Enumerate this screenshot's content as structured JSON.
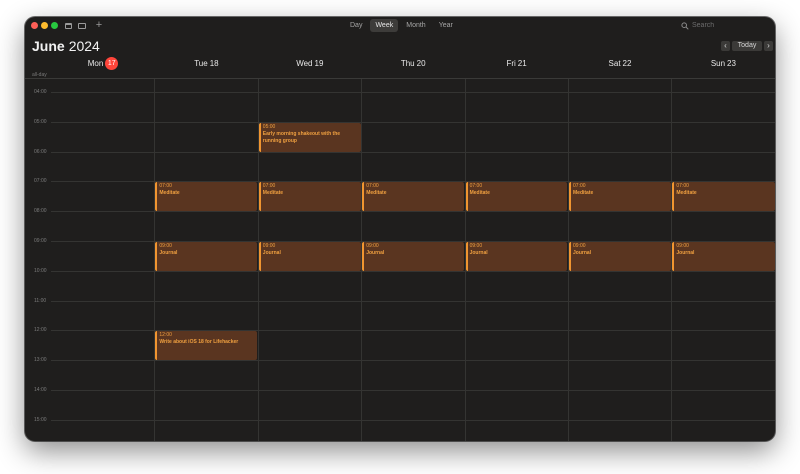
{
  "toolbar": {
    "views": [
      "Day",
      "Week",
      "Month",
      "Year"
    ],
    "active_view": "Week",
    "search_placeholder": "Search"
  },
  "header": {
    "month": "June",
    "year": "2024",
    "today_label": "Today"
  },
  "allday_label": "all-day",
  "days": [
    {
      "dow": "Mon",
      "num": "17",
      "today": true
    },
    {
      "dow": "Tue",
      "num": "18",
      "today": false
    },
    {
      "dow": "Wed",
      "num": "19",
      "today": false
    },
    {
      "dow": "Thu",
      "num": "20",
      "today": false
    },
    {
      "dow": "Fri",
      "num": "21",
      "today": false
    },
    {
      "dow": "Sat",
      "num": "22",
      "today": false
    },
    {
      "dow": "Sun",
      "num": "23",
      "today": false
    }
  ],
  "hours": [
    "04:00",
    "05:00",
    "06:00",
    "07:00",
    "08:00",
    "09:00",
    "10:00",
    "11:00",
    "12:00",
    "13:00",
    "14:00",
    "15:00"
  ],
  "events": [
    {
      "day": 2,
      "start": "05:00",
      "end": "06:00",
      "time": "05:00",
      "title": "Early morning shakeout with the running group"
    },
    {
      "day": 1,
      "start": "07:00",
      "end": "08:00",
      "time": "07:00",
      "title": "Meditate"
    },
    {
      "day": 2,
      "start": "07:00",
      "end": "08:00",
      "time": "07:00",
      "title": "Meditate"
    },
    {
      "day": 3,
      "start": "07:00",
      "end": "08:00",
      "time": "07:00",
      "title": "Meditate"
    },
    {
      "day": 4,
      "start": "07:00",
      "end": "08:00",
      "time": "07:00",
      "title": "Meditate"
    },
    {
      "day": 5,
      "start": "07:00",
      "end": "08:00",
      "time": "07:00",
      "title": "Meditate"
    },
    {
      "day": 6,
      "start": "07:00",
      "end": "08:00",
      "time": "07:00",
      "title": "Meditate"
    },
    {
      "day": 1,
      "start": "09:00",
      "end": "10:00",
      "time": "09:00",
      "title": "Journal"
    },
    {
      "day": 2,
      "start": "09:00",
      "end": "10:00",
      "time": "09:00",
      "title": "Journal"
    },
    {
      "day": 3,
      "start": "09:00",
      "end": "10:00",
      "time": "09:00",
      "title": "Journal"
    },
    {
      "day": 4,
      "start": "09:00",
      "end": "10:00",
      "time": "09:00",
      "title": "Journal"
    },
    {
      "day": 5,
      "start": "09:00",
      "end": "10:00",
      "time": "09:00",
      "title": "Journal"
    },
    {
      "day": 6,
      "start": "09:00",
      "end": "10:00",
      "time": "09:00",
      "title": "Journal"
    },
    {
      "day": 1,
      "start": "12:00",
      "end": "13:00",
      "time": "12:00",
      "title": "Write about iOS 18 for Lifehacker"
    }
  ],
  "colors": {
    "window_bg": "#1f1e1d",
    "event_fill": "#5a3520",
    "event_accent": "#f09530",
    "today_badge": "#ff453a"
  }
}
